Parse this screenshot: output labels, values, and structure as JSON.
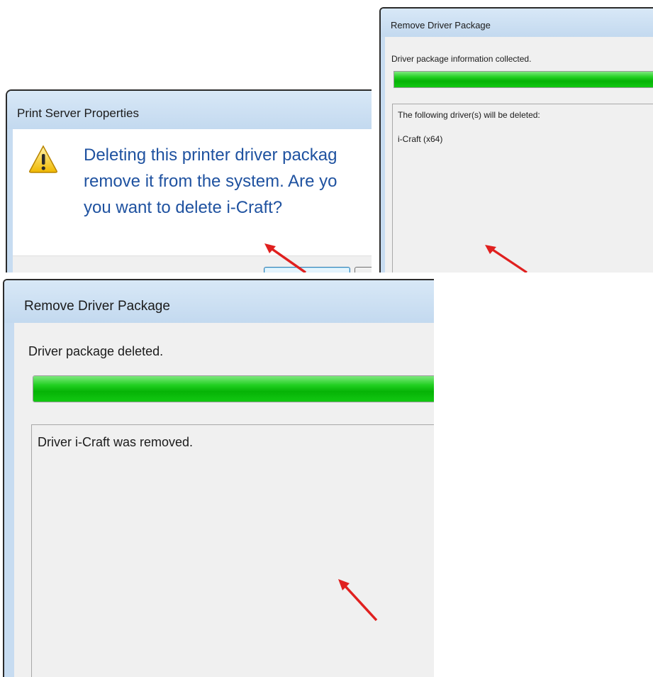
{
  "print_server_dialog": {
    "title": "Print Server Properties",
    "message_line1": "Deleting this printer driver packag",
    "message_line2": "remove it from the system. Are yo",
    "message_line3": "you want to delete i-Craft?"
  },
  "remove_dialog_collected": {
    "title": "Remove Driver Package",
    "status": "Driver package information collected.",
    "progress": 1.0,
    "list_header": "The following driver(s) will be deleted:",
    "list_items": [
      "i-Craft (x64)"
    ]
  },
  "remove_dialog_deleted": {
    "title": "Remove Driver Package",
    "status": "Driver package deleted.",
    "progress": 1.0,
    "result": "Driver i-Craft was removed."
  },
  "icons": {
    "warning": "warning-icon",
    "arrow": "red-arrow-annotation"
  },
  "colors": {
    "message_text": "#1f52a0",
    "progress_fill": "#06b306",
    "arrow": "#e0201f"
  }
}
